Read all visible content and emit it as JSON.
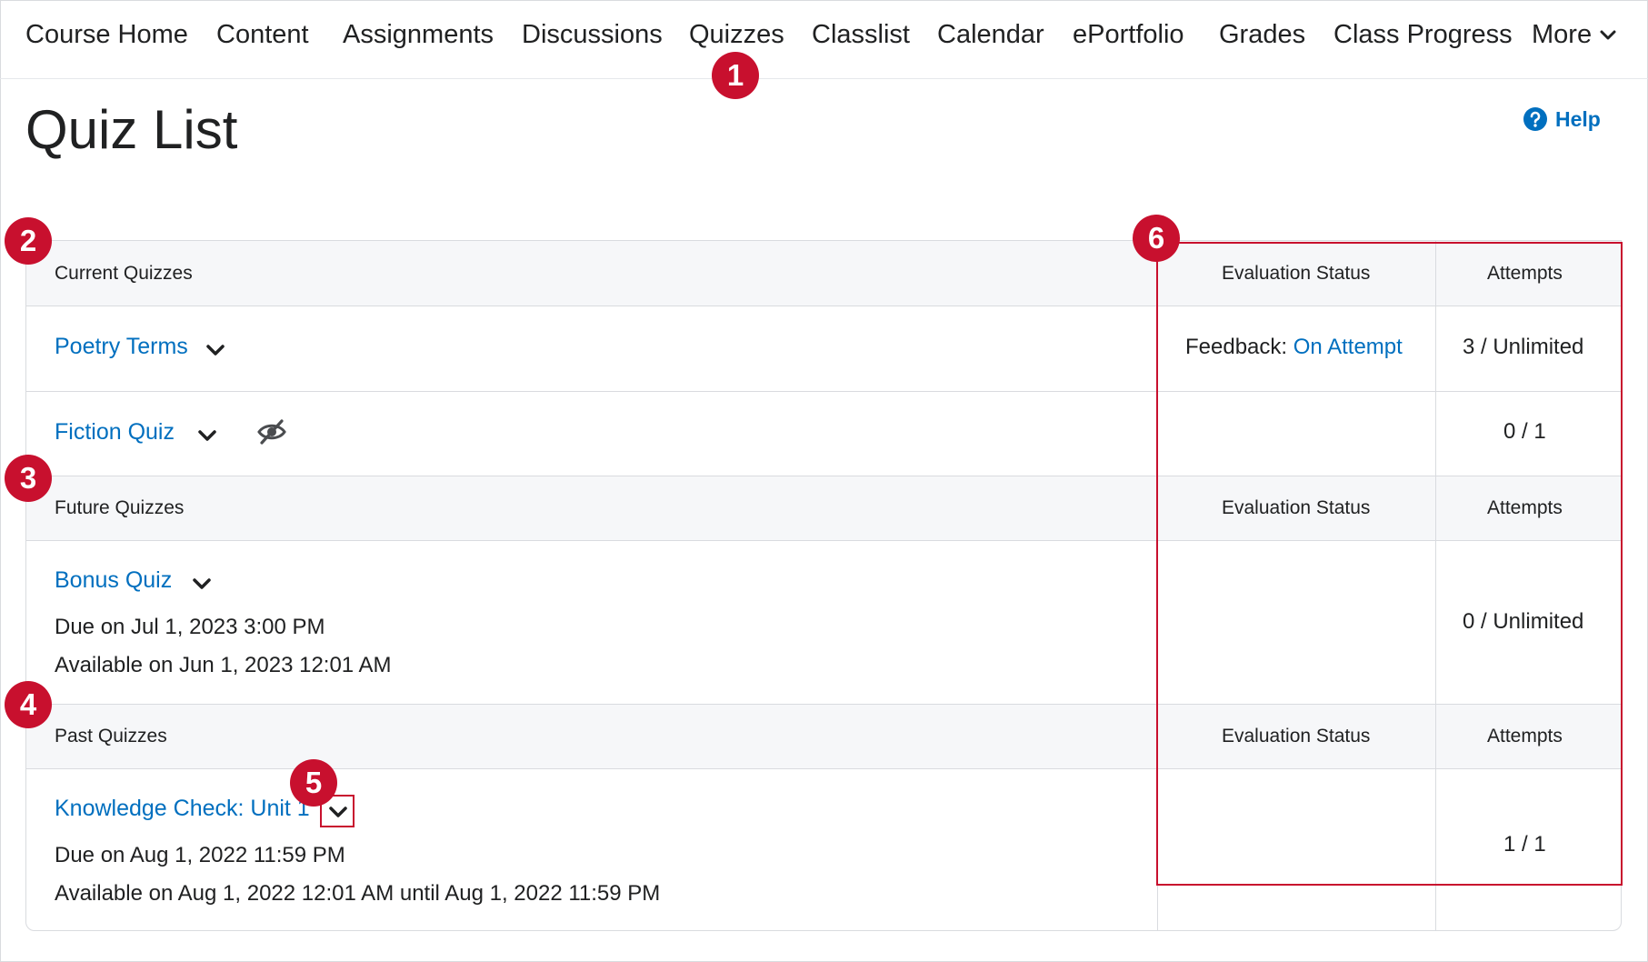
{
  "nav": {
    "items": [
      "Course Home",
      "Content",
      "Assignments",
      "Discussions",
      "Quizzes",
      "Classlist",
      "Calendar",
      "ePortfolio",
      "Grades",
      "Class Progress"
    ],
    "more_label": "More"
  },
  "page": {
    "title": "Quiz List",
    "help_label": "Help"
  },
  "sections": [
    {
      "heading": "Current Quizzes",
      "col_eval": "Evaluation Status",
      "col_attempts": "Attempts",
      "quizzes": [
        {
          "title": "Poetry Terms",
          "eval_prefix": "Feedback:",
          "eval_link": "On Attempt",
          "attempts": "3 / Unlimited"
        },
        {
          "title": "Fiction Quiz",
          "attempts": "0 / 1",
          "hidden_icon": "eye-hidden-icon"
        }
      ]
    },
    {
      "heading": "Future Quizzes",
      "col_eval": "Evaluation Status",
      "col_attempts": "Attempts",
      "quizzes": [
        {
          "title": "Bonus Quiz",
          "due": "Due on Jul 1, 2023 3:00 PM",
          "available": "Available on Jun 1, 2023 12:01 AM",
          "attempts": "0 / Unlimited"
        }
      ]
    },
    {
      "heading": "Past Quizzes",
      "col_eval": "Evaluation Status",
      "col_attempts": "Attempts",
      "quizzes": [
        {
          "title": "Knowledge Check: Unit 1",
          "due": "Due on Aug 1, 2022 11:59 PM",
          "available": "Available on Aug 1, 2022 12:01 AM until Aug 1, 2022 11:59 PM",
          "attempts": "1 / 1"
        }
      ]
    }
  ],
  "annotations": [
    "1",
    "2",
    "3",
    "4",
    "5",
    "6"
  ],
  "colors": {
    "link": "#006fbf",
    "annotation": "#c8102e",
    "header_bg": "#f6f7f9",
    "border": "#d9dbdf"
  }
}
